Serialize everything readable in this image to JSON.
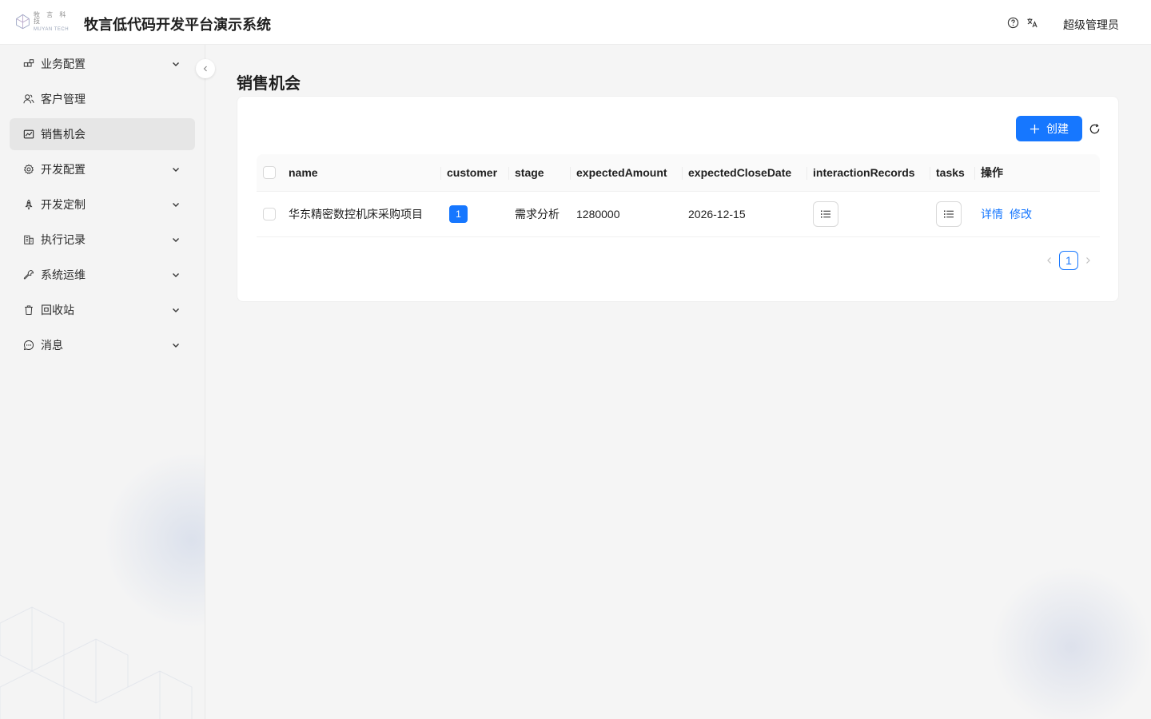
{
  "header": {
    "logo_cn": "牧 言 科 技",
    "logo_en": "MUYAN TECH",
    "title": "牧言低代码开发平台演示系统",
    "user_name": "超级管理员"
  },
  "sidebar": {
    "items": [
      {
        "label": "业务配置",
        "icon": "blocks-icon",
        "has_children": true
      },
      {
        "label": "客户管理",
        "icon": "users-icon",
        "has_children": false
      },
      {
        "label": "销售机会",
        "icon": "chart-line-icon",
        "has_children": false,
        "active": true
      },
      {
        "label": "开发配置",
        "icon": "gear-icon",
        "has_children": true
      },
      {
        "label": "开发定制",
        "icon": "rocket-icon",
        "has_children": true
      },
      {
        "label": "执行记录",
        "icon": "building-icon",
        "has_children": true
      },
      {
        "label": "系统运维",
        "icon": "wrench-icon",
        "has_children": true
      },
      {
        "label": "回收站",
        "icon": "trash-icon",
        "has_children": true
      },
      {
        "label": "消息",
        "icon": "message-icon",
        "has_children": true
      }
    ]
  },
  "main": {
    "page_title": "销售机会",
    "create_label": "创建",
    "table": {
      "columns": [
        "name",
        "customer",
        "stage",
        "expectedAmount",
        "expectedCloseDate",
        "interactionRecords",
        "tasks",
        "操作"
      ],
      "rows": [
        {
          "name": "华东精密数控机床采购项目",
          "customer": "1",
          "stage": "需求分析",
          "expectedAmount": "1280000",
          "expectedCloseDate": "2026-12-15",
          "actions": [
            "详情",
            "修改"
          ]
        }
      ]
    },
    "pagination": {
      "current": "1"
    }
  },
  "colors": {
    "primary": "#1677ff",
    "sidebar_active": "#e6e6e6"
  }
}
